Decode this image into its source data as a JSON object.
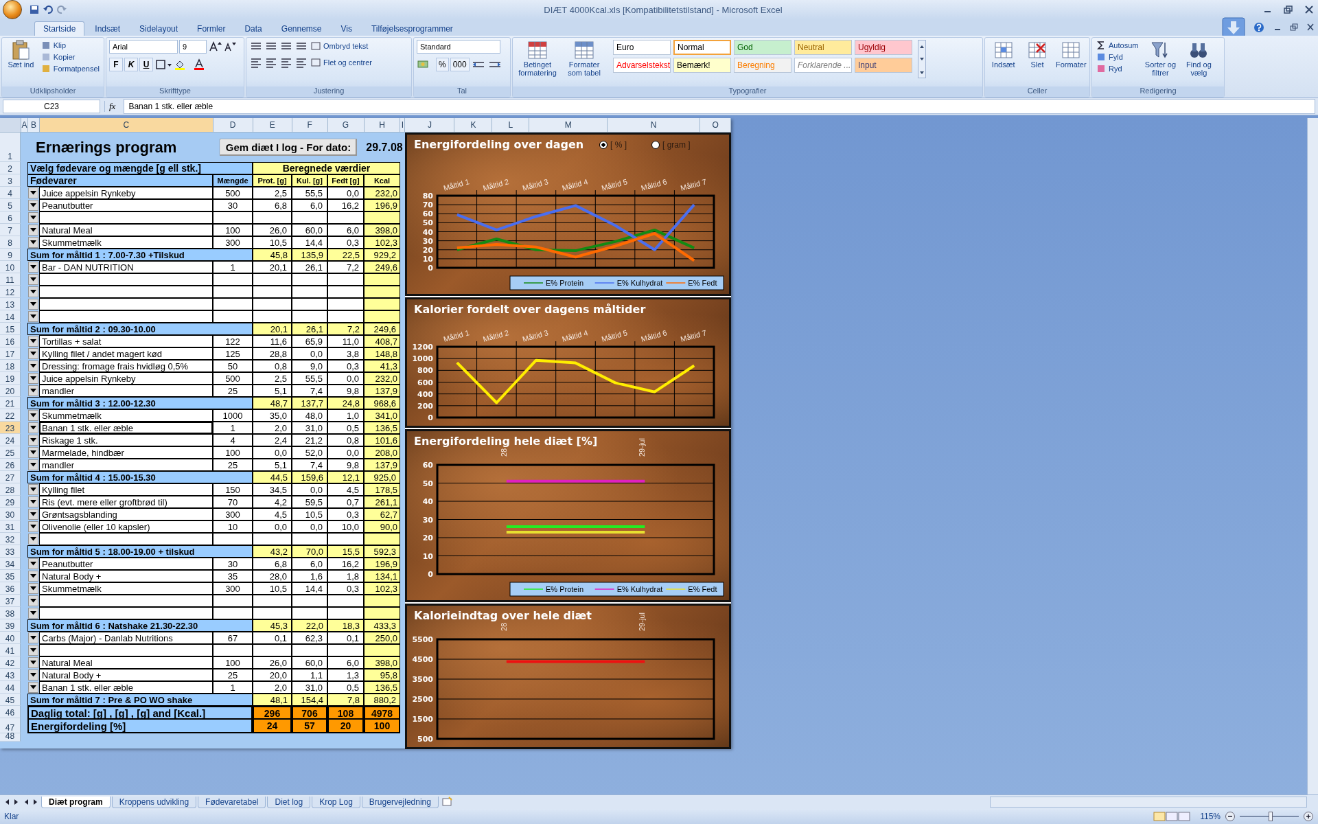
{
  "window": {
    "title": "DIÆT 4000Kcal.xls  [Kompatibilitetstilstand] - Microsoft Excel"
  },
  "ribbon_tabs": [
    {
      "label": "Startside",
      "selected": true
    },
    {
      "label": "Indsæt",
      "selected": false
    },
    {
      "label": "Sidelayout",
      "selected": false
    },
    {
      "label": "Formler",
      "selected": false
    },
    {
      "label": "Data",
      "selected": false
    },
    {
      "label": "Gennemse",
      "selected": false
    },
    {
      "label": "Vis",
      "selected": false
    },
    {
      "label": "Tilføjelsesprogrammer",
      "selected": false
    }
  ],
  "ribbon_groups": [
    {
      "kind": "clipboard",
      "label": "Udklipsholder",
      "big": [
        "Sæt ind"
      ],
      "items": [
        "Klip",
        "Kopier",
        "Formatpensel"
      ]
    },
    {
      "kind": "font",
      "label": "Skrifttype",
      "font": "Arial",
      "size": "9",
      "buttons": [
        "F",
        "K",
        "U"
      ]
    },
    {
      "kind": "align",
      "label": "Justering",
      "items": [
        "Ombryd tekst",
        "Flet og centrer"
      ]
    },
    {
      "kind": "number",
      "label": "Tal",
      "format": "Standard",
      "buttons": [
        "%",
        "000"
      ]
    },
    {
      "kind": "styles",
      "label": "Typografier",
      "big": [
        "Betinget formatering",
        "Formater som tabel"
      ],
      "styles": [
        {
          "label": "Euro",
          "color": "#ffffff",
          "selected": false
        },
        {
          "label": "Normal",
          "color": "#ffffff",
          "selected": true
        },
        {
          "label": "God",
          "color": "#c6efce",
          "selected": false
        },
        {
          "label": "Neutral",
          "color": "#ffeb9c",
          "selected": false
        },
        {
          "label": "Ugyldig",
          "color": "#ffc7ce",
          "selected": false
        },
        {
          "label": "Advarselstekst",
          "color": "#ffffff",
          "selected": false
        },
        {
          "label": "Bemærk!",
          "color": "#ffffcc",
          "selected": false
        },
        {
          "label": "Beregning",
          "color": "#f2f2f2",
          "selected": false
        },
        {
          "label": "Forklarende ...",
          "color": "#ffffff",
          "selected": false
        },
        {
          "label": "Input",
          "color": "#ffcc99",
          "selected": false
        }
      ]
    },
    {
      "kind": "cells",
      "label": "Celler",
      "big": [
        "Indsæt",
        "Slet",
        "Formater"
      ]
    },
    {
      "kind": "editing",
      "label": "Redigering",
      "items": [
        "Autosum",
        "Fyld",
        "Ryd"
      ],
      "big": [
        "Sorter og filtrer",
        "Find og vælg"
      ]
    }
  ],
  "formula_bar": {
    "cell": "C23",
    "function_label": "fx",
    "formula": "Banan 1 stk. eller æble"
  },
  "columns": [
    {
      "label": "A",
      "selected": false
    },
    {
      "label": "B",
      "selected": false
    },
    {
      "label": "C",
      "selected": true
    },
    {
      "label": "D",
      "selected": false
    },
    {
      "label": "E",
      "selected": false
    },
    {
      "label": "F",
      "selected": false
    },
    {
      "label": "G",
      "selected": false
    },
    {
      "label": "H",
      "selected": false
    },
    {
      "label": "I",
      "selected": false
    },
    {
      "label": "J",
      "selected": false
    },
    {
      "label": "K",
      "selected": false
    },
    {
      "label": "L",
      "selected": false
    },
    {
      "label": "M",
      "selected": false
    },
    {
      "label": "N",
      "selected": false
    },
    {
      "label": "O",
      "selected": false
    }
  ],
  "rows": [
    {
      "row": "1",
      "kind": "title",
      "selected": false,
      "title": "Ernærings program",
      "button": "Gem diæt I log - For dato:",
      "date": "29.7.08"
    },
    {
      "row": "2",
      "kind": "header",
      "selected": false,
      "left": "Vælg fødevare og mængde [g ell stk.]",
      "right": "Beregnede værdier"
    },
    {
      "row": "3",
      "kind": "subheader",
      "selected": false,
      "cells": [
        "Fødevarer",
        "Mængde",
        "Prot. [g]",
        "Kul. [g]",
        "Fedt [g]",
        "Kcal"
      ]
    },
    {
      "row": "4",
      "kind": "food",
      "selected": false,
      "cells": [
        "Juice appelsin Rynkeby",
        "500",
        "2,5",
        "55,5",
        "0,0",
        "232,0"
      ]
    },
    {
      "row": "5",
      "kind": "food",
      "selected": false,
      "cells": [
        "Peanutbutter",
        "30",
        "6,8",
        "6,0",
        "16,2",
        "196,9"
      ]
    },
    {
      "row": "6",
      "kind": "food",
      "selected": false,
      "cells": []
    },
    {
      "row": "7",
      "kind": "food",
      "selected": false,
      "cells": [
        "Natural Meal",
        "100",
        "26,0",
        "60,0",
        "6,0",
        "398,0"
      ]
    },
    {
      "row": "8",
      "kind": "food",
      "selected": false,
      "cells": [
        "Skummetmælk",
        "300",
        "10,5",
        "14,4",
        "0,3",
        "102,3"
      ]
    },
    {
      "row": "9",
      "kind": "sum",
      "selected": false,
      "label": "Sum for måltid 1 : 7.00-7.30 +Tilskud",
      "cells": [
        "45,8",
        "135,9",
        "22,5",
        "929,2"
      ]
    },
    {
      "row": "10",
      "kind": "food",
      "selected": false,
      "cells": [
        "Bar - DAN NUTRITION",
        "1",
        "20,1",
        "26,1",
        "7,2",
        "249,6"
      ]
    },
    {
      "row": "11",
      "kind": "food",
      "selected": false,
      "cells": []
    },
    {
      "row": "12",
      "kind": "food",
      "selected": false,
      "cells": []
    },
    {
      "row": "13",
      "kind": "food",
      "selected": false,
      "cells": []
    },
    {
      "row": "14",
      "kind": "food",
      "selected": false,
      "cells": []
    },
    {
      "row": "15",
      "kind": "sum",
      "selected": false,
      "label": "Sum for måltid 2 : 09.30-10.00",
      "cells": [
        "20,1",
        "26,1",
        "7,2",
        "249,6"
      ]
    },
    {
      "row": "16",
      "kind": "food",
      "selected": false,
      "cells": [
        "Tortillas + salat",
        "122",
        "11,6",
        "65,9",
        "11,0",
        "408,7"
      ]
    },
    {
      "row": "17",
      "kind": "food",
      "selected": false,
      "cells": [
        "Kylling filet / andet magert kød",
        "125",
        "28,8",
        "0,0",
        "3,8",
        "148,8"
      ]
    },
    {
      "row": "18",
      "kind": "food",
      "selected": false,
      "cells": [
        "Dressing: fromage frais hvidløg 0,5%",
        "50",
        "0,8",
        "9,0",
        "0,3",
        "41,3"
      ]
    },
    {
      "row": "19",
      "kind": "food",
      "selected": false,
      "cells": [
        "Juice appelsin Rynkeby",
        "500",
        "2,5",
        "55,5",
        "0,0",
        "232,0"
      ]
    },
    {
      "row": "20",
      "kind": "food",
      "selected": false,
      "cells": [
        "mandler",
        "25",
        "5,1",
        "7,4",
        "9,8",
        "137,9"
      ]
    },
    {
      "row": "21",
      "kind": "sum",
      "selected": false,
      "label": "Sum for måltid 3 : 12.00-12.30",
      "cells": [
        "48,7",
        "137,7",
        "24,8",
        "968,6"
      ]
    },
    {
      "row": "22",
      "kind": "food",
      "selected": false,
      "cells": [
        "Skummetmælk",
        "1000",
        "35,0",
        "48,0",
        "1,0",
        "341,0"
      ]
    },
    {
      "row": "23",
      "kind": "food",
      "selected": true,
      "cells": [
        "Banan 1 stk. eller æble",
        "1",
        "2,0",
        "31,0",
        "0,5",
        "136,5"
      ]
    },
    {
      "row": "24",
      "kind": "food",
      "selected": false,
      "cells": [
        "Riskage 1 stk.",
        "4",
        "2,4",
        "21,2",
        "0,8",
        "101,6"
      ]
    },
    {
      "row": "25",
      "kind": "food",
      "selected": false,
      "cells": [
        "Marmelade, hindbær",
        "100",
        "0,0",
        "52,0",
        "0,0",
        "208,0"
      ]
    },
    {
      "row": "26",
      "kind": "food",
      "selected": false,
      "cells": [
        "mandler",
        "25",
        "5,1",
        "7,4",
        "9,8",
        "137,9"
      ]
    },
    {
      "row": "27",
      "kind": "sum",
      "selected": false,
      "label": "Sum for måltid 4 : 15.00-15.30",
      "cells": [
        "44,5",
        "159,6",
        "12,1",
        "925,0"
      ]
    },
    {
      "row": "28",
      "kind": "food",
      "selected": false,
      "cells": [
        "Kylling filet",
        "150",
        "34,5",
        "0,0",
        "4,5",
        "178,5"
      ]
    },
    {
      "row": "29",
      "kind": "food",
      "selected": false,
      "cells": [
        "Ris (evt. mere eller groftbrød til)",
        "70",
        "4,2",
        "59,5",
        "0,7",
        "261,1"
      ]
    },
    {
      "row": "30",
      "kind": "food",
      "selected": false,
      "cells": [
        "Grøntsagsblanding",
        "300",
        "4,5",
        "10,5",
        "0,3",
        "62,7"
      ]
    },
    {
      "row": "31",
      "kind": "food",
      "selected": false,
      "cells": [
        "Olivenolie (eller 10 kapsler)",
        "10",
        "0,0",
        "0,0",
        "10,0",
        "90,0"
      ]
    },
    {
      "row": "32",
      "kind": "food",
      "selected": false,
      "cells": []
    },
    {
      "row": "33",
      "kind": "sum",
      "selected": false,
      "label": "Sum for måltid 5 : 18.00-19.00 + tilskud",
      "cells": [
        "43,2",
        "70,0",
        "15,5",
        "592,3"
      ]
    },
    {
      "row": "34",
      "kind": "food",
      "selected": false,
      "cells": [
        "Peanutbutter",
        "30",
        "6,8",
        "6,0",
        "16,2",
        "196,9"
      ]
    },
    {
      "row": "35",
      "kind": "food",
      "selected": false,
      "cells": [
        "Natural Body +",
        "35",
        "28,0",
        "1,6",
        "1,8",
        "134,1"
      ]
    },
    {
      "row": "36",
      "kind": "food",
      "selected": false,
      "cells": [
        "Skummetmælk",
        "300",
        "10,5",
        "14,4",
        "0,3",
        "102,3"
      ]
    },
    {
      "row": "37",
      "kind": "food",
      "selected": false,
      "cells": []
    },
    {
      "row": "38",
      "kind": "food",
      "selected": false,
      "cells": []
    },
    {
      "row": "39",
      "kind": "sum",
      "selected": false,
      "label": "Sum for måltid 6 : Natshake 21.30-22.30",
      "cells": [
        "45,3",
        "22,0",
        "18,3",
        "433,3"
      ]
    },
    {
      "row": "40",
      "kind": "food",
      "selected": false,
      "cells": [
        "Carbs (Major) - Danlab Nutritions",
        "67",
        "0,1",
        "62,3",
        "0,1",
        "250,0"
      ]
    },
    {
      "row": "41",
      "kind": "food",
      "selected": false,
      "cells": []
    },
    {
      "row": "42",
      "kind": "food",
      "selected": false,
      "cells": [
        "Natural Meal",
        "100",
        "26,0",
        "60,0",
        "6,0",
        "398,0"
      ]
    },
    {
      "row": "43",
      "kind": "food",
      "selected": false,
      "cells": [
        "Natural Body +",
        "25",
        "20,0",
        "1,1",
        "1,3",
        "95,8"
      ]
    },
    {
      "row": "44",
      "kind": "food",
      "selected": false,
      "cells": [
        "Banan 1 stk. eller æble",
        "1",
        "2,0",
        "31,0",
        "0,5",
        "136,5"
      ]
    },
    {
      "row": "45",
      "kind": "sum",
      "selected": false,
      "label": "Sum for måltid 7 : Pre & PO WO shake",
      "cells": [
        "48,1",
        "154,4",
        "7,8",
        "880,2"
      ]
    },
    {
      "row": "46",
      "kind": "total",
      "selected": false,
      "label": "Daglig total: [g] , [g] , [g] and [Kcal.]",
      "cells": [
        "296",
        "706",
        "108",
        "4978"
      ]
    },
    {
      "row": "47",
      "kind": "total",
      "selected": false,
      "label": "Energifordeling  [%]",
      "cells": [
        "24",
        "57",
        "20",
        "100"
      ]
    },
    {
      "row": "48",
      "kind": "blank",
      "selected": false
    }
  ],
  "charts": [
    {
      "options": [
        {
          "label": "[ % ]",
          "selected": true
        },
        {
          "label": "[ gram ]",
          "selected": false
        }
      ],
      "chart_data": {
        "type": "line",
        "grid": true,
        "legend": "bottom-right",
        "title": "Energifordeling over dagen",
        "categories": [
          "Måltid 1",
          "Måltid 2",
          "Måltid 3",
          "Måltid 4",
          "Måltid 5",
          "Måltid 6",
          "Måltid 7"
        ],
        "ylim": [
          0,
          80
        ],
        "yticks": [
          0,
          10,
          20,
          30,
          40,
          50,
          60,
          70,
          80
        ],
        "series": [
          {
            "name": "E% Protein",
            "color": "#138a13",
            "values": [
              20,
              32,
              20,
              19,
              29,
              42,
              22
            ]
          },
          {
            "name": "E% Kulhydrat",
            "color": "#4a6ef0",
            "values": [
              59,
              42,
              57,
              69,
              47,
              20,
              70
            ]
          },
          {
            "name": "E% Fedt",
            "color": "#ff6a00",
            "values": [
              22,
              26,
              23,
              12,
              24,
              38,
              8
            ]
          }
        ]
      }
    },
    {
      "chart_data": {
        "type": "line",
        "grid": true,
        "title": "Kalorier fordelt over dagens måltider",
        "categories": [
          "Måltid 1",
          "Måltid 2",
          "Måltid 3",
          "Måltid 4",
          "Måltid 5",
          "Måltid 6",
          "Måltid 7"
        ],
        "ylim": [
          0,
          1200
        ],
        "yticks": [
          0,
          200,
          400,
          600,
          800,
          1000,
          1200
        ],
        "series": [
          {
            "color": "#ffee00",
            "values": [
              930,
              250,
              970,
              925,
              590,
              435,
              880
            ]
          }
        ]
      }
    },
    {
      "chart_data": {
        "type": "line",
        "grid": true,
        "legend": "bottom-right",
        "title": "Energifordeling hele diæt [%]",
        "categories": [
          "28",
          "29-jul"
        ],
        "ylim": [
          0,
          60
        ],
        "yticks": [
          0,
          10,
          20,
          30,
          40,
          50,
          60
        ],
        "series": [
          {
            "name": "E% Protein",
            "color": "#22ee22",
            "values": [
              26,
              26
            ]
          },
          {
            "name": "E% Kulhydrat",
            "color": "#e020c0",
            "values": [
              51,
              51
            ]
          },
          {
            "name": "E% Fedt",
            "color": "#e8e030",
            "values": [
              23,
              23
            ]
          }
        ]
      }
    },
    {
      "chart_data": {
        "type": "line",
        "grid": true,
        "title": "Kalorieindtag over hele diæt",
        "categories": [
          "28",
          "29-jul"
        ],
        "ylim": [
          500,
          5500
        ],
        "yticks": [
          500,
          1500,
          2500,
          3500,
          4500,
          5500
        ],
        "series": [
          {
            "color": "#ee1111",
            "values": [
              4380,
              4380
            ]
          }
        ]
      }
    }
  ],
  "sheet_tabs": [
    {
      "label": "Diæt program",
      "selected": true
    },
    {
      "label": "Kroppens udvikling",
      "selected": false
    },
    {
      "label": "Fødevaretabel",
      "selected": false
    },
    {
      "label": "Diet log",
      "selected": false
    },
    {
      "label": "Krop Log",
      "selected": false
    },
    {
      "label": "Brugervejledning",
      "selected": false
    }
  ],
  "status_bar": {
    "status": "Klar",
    "zoom": "115%",
    "zoom_slider": {
      "level": 0.52
    }
  }
}
